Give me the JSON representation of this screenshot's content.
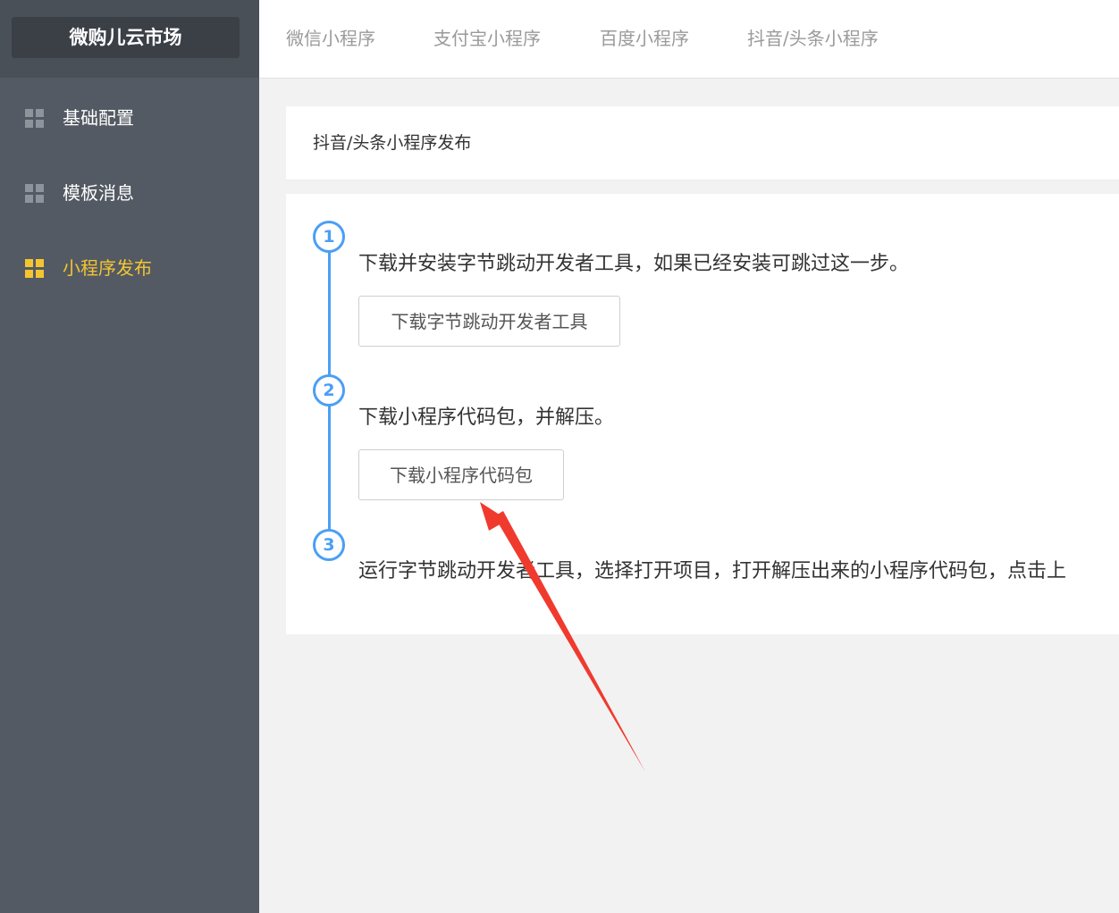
{
  "brand": {
    "title": "微购儿云市场"
  },
  "sidebar": {
    "items": [
      {
        "label": "基础配置",
        "icon": "grid-icon",
        "active": false
      },
      {
        "label": "模板消息",
        "icon": "grid-icon",
        "active": false
      },
      {
        "label": "小程序发布",
        "icon": "grid-icon",
        "active": true
      }
    ]
  },
  "tabs": [
    {
      "label": "微信小程序"
    },
    {
      "label": "支付宝小程序"
    },
    {
      "label": "百度小程序"
    },
    {
      "label": "抖音/头条小程序"
    }
  ],
  "page": {
    "title": "抖音/头条小程序发布"
  },
  "steps": [
    {
      "number": "1",
      "text": "下载并安装字节跳动开发者工具，如果已经安装可跳过这一步。",
      "button": "下载字节跳动开发者工具"
    },
    {
      "number": "2",
      "text": "下载小程序代码包，并解压。",
      "button": "下载小程序代码包"
    },
    {
      "number": "3",
      "text": "运行字节跳动开发者工具，选择打开项目，打开解压出来的小程序代码包，点击上"
    }
  ],
  "colors": {
    "sidebar_bg": "#535a63",
    "active": "#f5c531",
    "accent": "#4a9ff5",
    "annotation_arrow": "#f03a2e"
  }
}
